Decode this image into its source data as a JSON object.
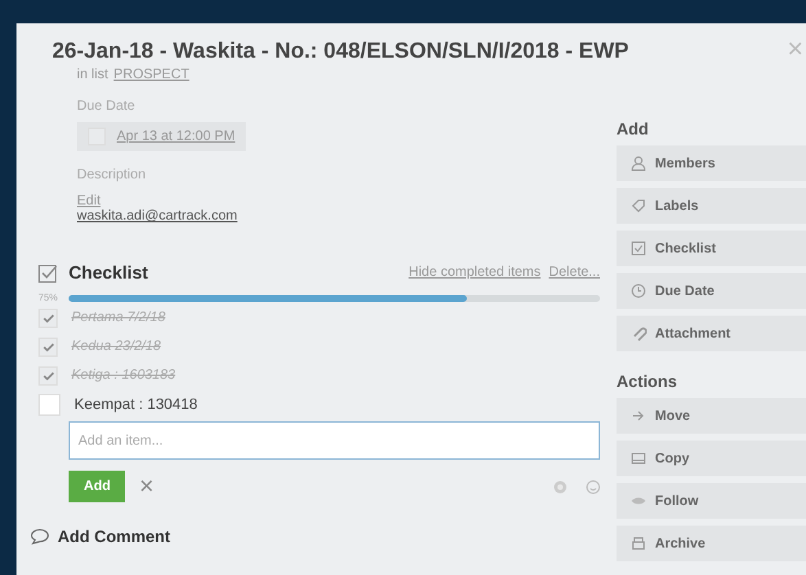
{
  "card": {
    "title": "26-Jan-18 - Waskita - No.: 048/ELSON/SLN/I/2018 - EWP",
    "list_prefix": "in list",
    "list_name": "PROSPECT",
    "due_label": "Due Date",
    "due_value": "Apr 13 at 12:00 PM",
    "due_done": false,
    "description_label": "Description",
    "edit_link": "Edit",
    "description": "waskita.adi@cartrack.com"
  },
  "checklist": {
    "title": "Checklist",
    "hide_link": "Hide completed items",
    "delete_link": "Delete...",
    "percent": "75%",
    "level": 0.75,
    "items": [
      {
        "text": "Pertama 7/2/18",
        "checked": true
      },
      {
        "text": "Kedua 23/2/18",
        "checked": true
      },
      {
        "text": "Ketiga : 1603183",
        "checked": true
      },
      {
        "text": "Keempat : 130418",
        "checked": false
      }
    ],
    "input": {
      "placeholder": "Add an item..."
    },
    "add_button": "Add",
    "cancel": "×"
  },
  "comment": {
    "title": "Add Comment"
  },
  "sidebar": [
    {
      "heading": "Add",
      "buttons": [
        {
          "label": "Members"
        },
        {
          "label": "Labels"
        },
        {
          "label": "Checklist"
        },
        {
          "label": "Due Date"
        },
        {
          "label": "Attachment"
        }
      ]
    },
    {
      "heading": "Actions",
      "buttons": [
        {
          "label": "Move"
        },
        {
          "label": "Copy"
        },
        {
          "label": "Follow"
        },
        {
          "label": "Archive"
        }
      ]
    }
  ],
  "close": "×"
}
